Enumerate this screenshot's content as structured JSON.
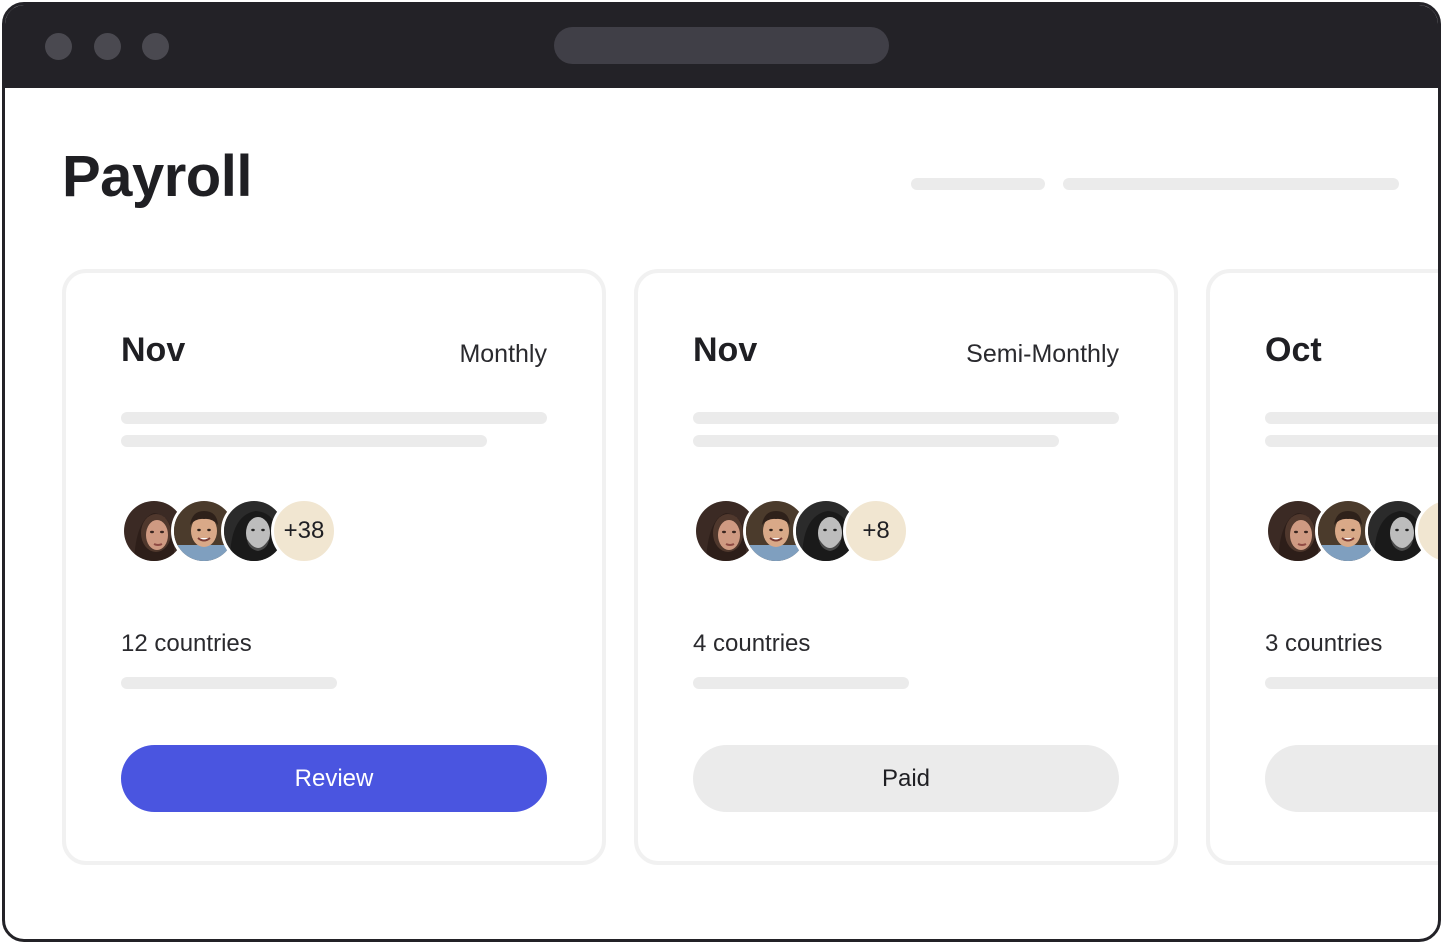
{
  "colors": {
    "chrome": "#232227",
    "primary_button": "#4a55e0",
    "muted_button": "#ebebeb",
    "more_badge": "#f1e6d1"
  },
  "page": {
    "title": "Payroll"
  },
  "cards": [
    {
      "month": "Nov",
      "frequency": "Monthly",
      "more_count": "+38",
      "countries": "12 countries",
      "action_label": "Review",
      "action_style": "primary"
    },
    {
      "month": "Nov",
      "frequency": "Semi-Monthly",
      "more_count": "+8",
      "countries": "4 countries",
      "action_label": "Paid",
      "action_style": "muted"
    },
    {
      "month": "Oct",
      "frequency": "",
      "more_count": "",
      "countries": "3 countries",
      "action_label": "",
      "action_style": "muted"
    }
  ],
  "icons": {
    "window_controls": [
      "close-dot",
      "minimize-dot",
      "maximize-dot"
    ],
    "avatars": [
      "avatar-woman",
      "avatar-man-smiling",
      "avatar-man-bearded"
    ]
  }
}
